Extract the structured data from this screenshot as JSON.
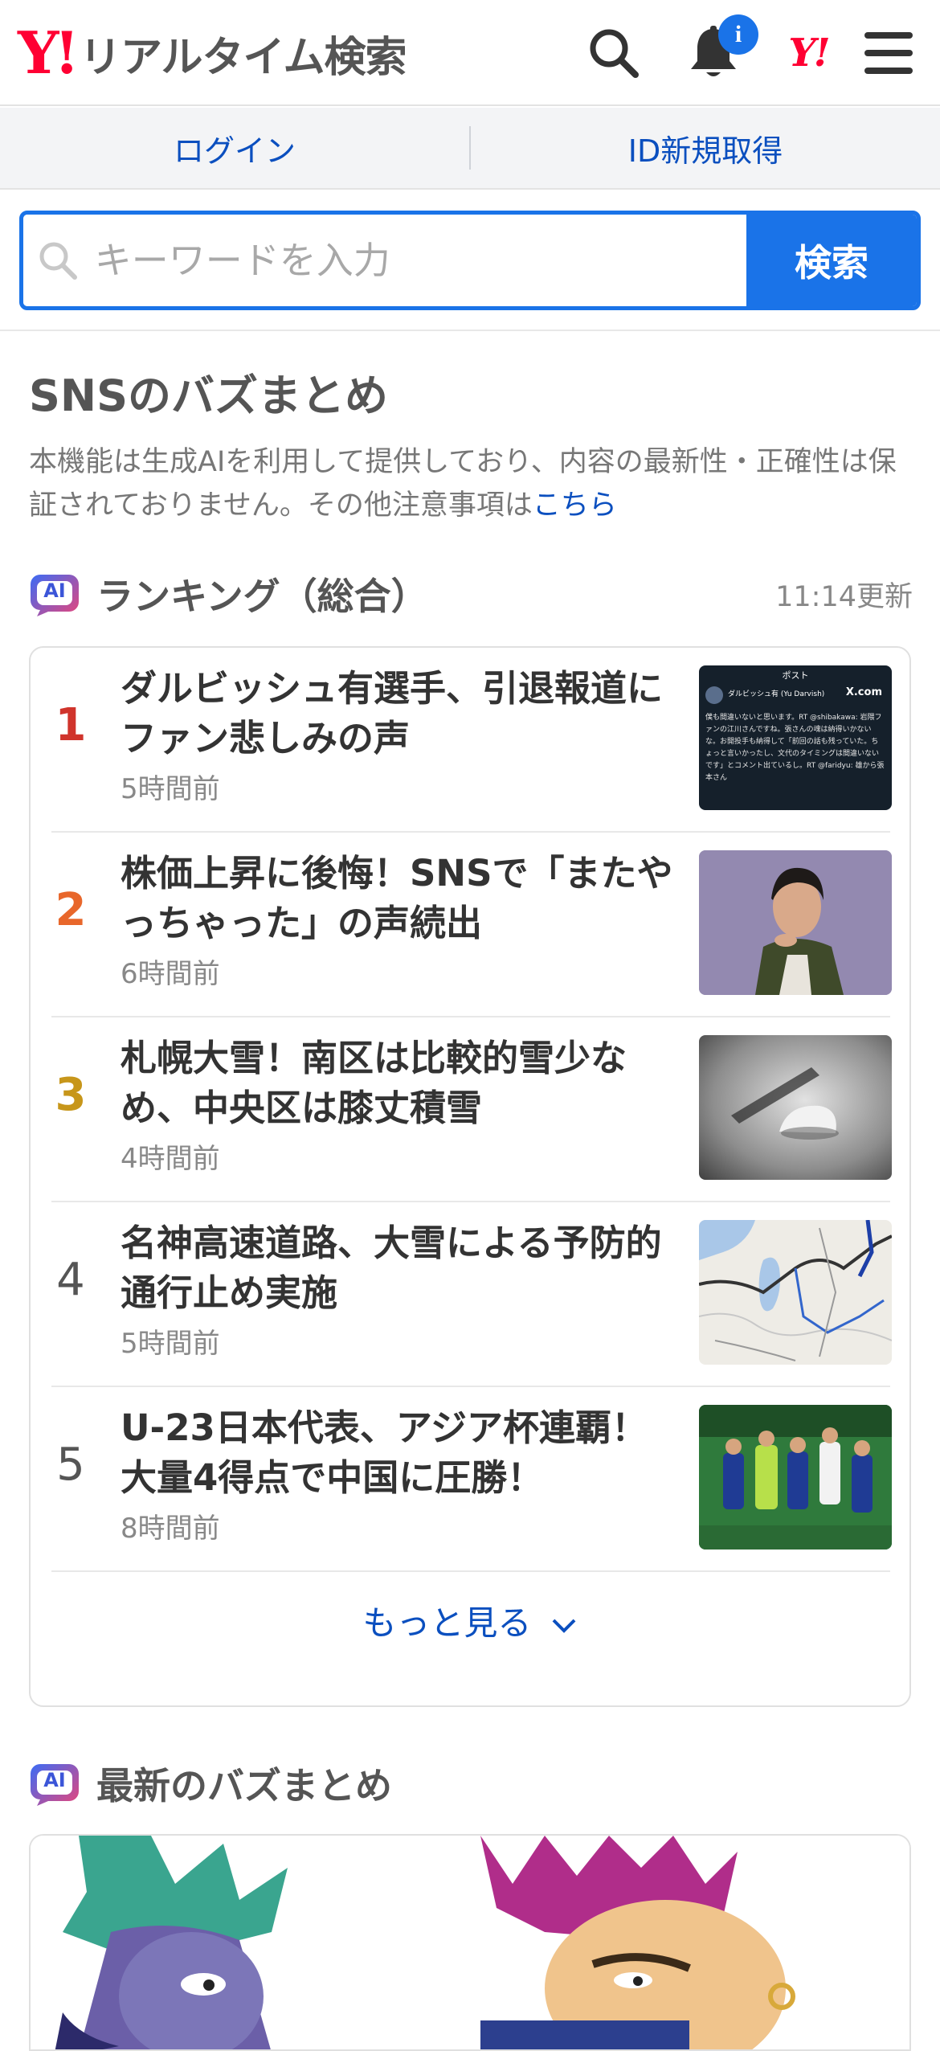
{
  "header": {
    "logo_mark": "Y!",
    "logo_text": "リアルタイム検索",
    "bell_badge": "i",
    "yahoo_mini": "Y!"
  },
  "login_bar": {
    "login": "ログイン",
    "signup": "ID新規取得"
  },
  "search": {
    "placeholder": "キーワードを入力",
    "button": "検索"
  },
  "sns": {
    "title": "SNSのバズまとめ",
    "description": "本機能は生成AIを利用して提供しており、内容の最新性・正確性は保証されておりません。その他注意事項は",
    "link": "こちら"
  },
  "ranking": {
    "ai_label": "AI",
    "title": "ランキング（総合）",
    "updated": "11:14更新",
    "items": [
      {
        "rank": "1",
        "title": "ダルビッシュ有選手、引退報道にファン悲しみの声",
        "time": "5時間前",
        "color": "#d0342c"
      },
      {
        "rank": "2",
        "title": "株価上昇に後悔！SNSで「またやっちゃった」の声続出",
        "time": "6時間前",
        "color": "#e8672b"
      },
      {
        "rank": "3",
        "title": "札幌大雪！南区は比較的雪少なめ、中央区は膝丈積雪",
        "time": "4時間前",
        "color": "#c7961a"
      },
      {
        "rank": "4",
        "title": "名神高速道路、大雪による予防的通行止め実施",
        "time": "5時間前",
        "color": "#555555"
      },
      {
        "rank": "5",
        "title": "U-23日本代表、アジア杯連覇！大量4得点で中国に圧勝！",
        "time": "8時間前",
        "color": "#555555"
      }
    ],
    "more": "もっと見る"
  },
  "tweet_thumb": {
    "header": "ポスト",
    "name": "ダルビッシュ有 (Yu Darvish)",
    "brand": "X.com",
    "body": "僕も間違いないと思います。RT @shibakawa: 岩隈ファンの江川さんですね。張さんの魂は納得いかないな。お開投手も納得して「前回の話も残っていた。ちょっと言いかったし、文代のタイミングは間違いないです」とコメント出ているし。RT @faridyu: 雄から張本さん"
  },
  "latest": {
    "ai_label": "AI",
    "title": "最新のバズまとめ"
  },
  "colors": {
    "brand_red": "#ff0033",
    "accent_blue": "#1a73e8",
    "link_blue": "#0b4fbf"
  }
}
